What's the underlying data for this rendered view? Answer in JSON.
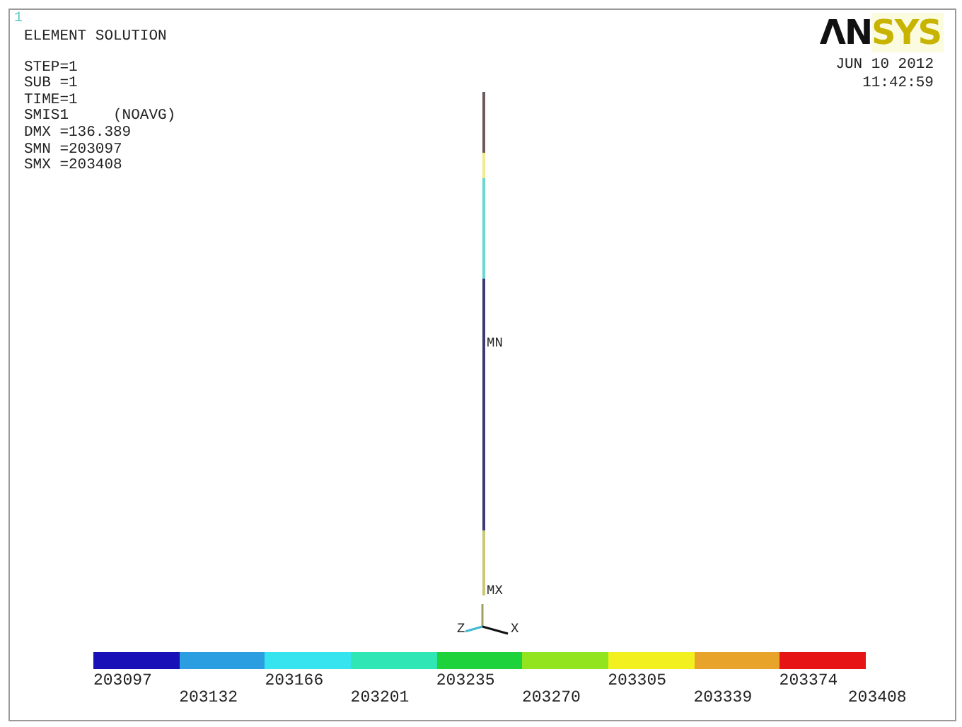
{
  "window_number": "1",
  "title": "ELEMENT SOLUTION",
  "info_lines": [
    "STEP=1",
    "SUB =1",
    "TIME=1",
    "SMIS1     (NOAVG)",
    "DMX =136.389",
    "SMN =203097",
    "SMX =203408"
  ],
  "logo": {
    "dark_part": "ΛN",
    "light_part": "SYS"
  },
  "date": "JUN 10 2012",
  "time": "11:42:59",
  "beam": {
    "segments": [
      {
        "color": "#6e5a5a"
      },
      {
        "color": "#f0ec8c"
      },
      {
        "color": "#6ad8d0"
      },
      {
        "color": "#3a3a78"
      },
      {
        "color": "#c8c87a"
      }
    ],
    "min_label": "MN",
    "max_label": "MX"
  },
  "triad": {
    "z_label": "Z",
    "x_label": "X"
  },
  "legend": {
    "bands": [
      {
        "color": "#1a10b8"
      },
      {
        "color": "#2a9ee0"
      },
      {
        "color": "#36e4f0"
      },
      {
        "color": "#30e6b4"
      },
      {
        "color": "#1ed23c"
      },
      {
        "color": "#92e41e"
      },
      {
        "color": "#f2f01e"
      },
      {
        "color": "#e8a42a"
      },
      {
        "color": "#e61414"
      }
    ],
    "labels": [
      "203097",
      "203132",
      "203166",
      "203201",
      "203235",
      "203270",
      "203305",
      "203339",
      "203374",
      "203408"
    ]
  }
}
